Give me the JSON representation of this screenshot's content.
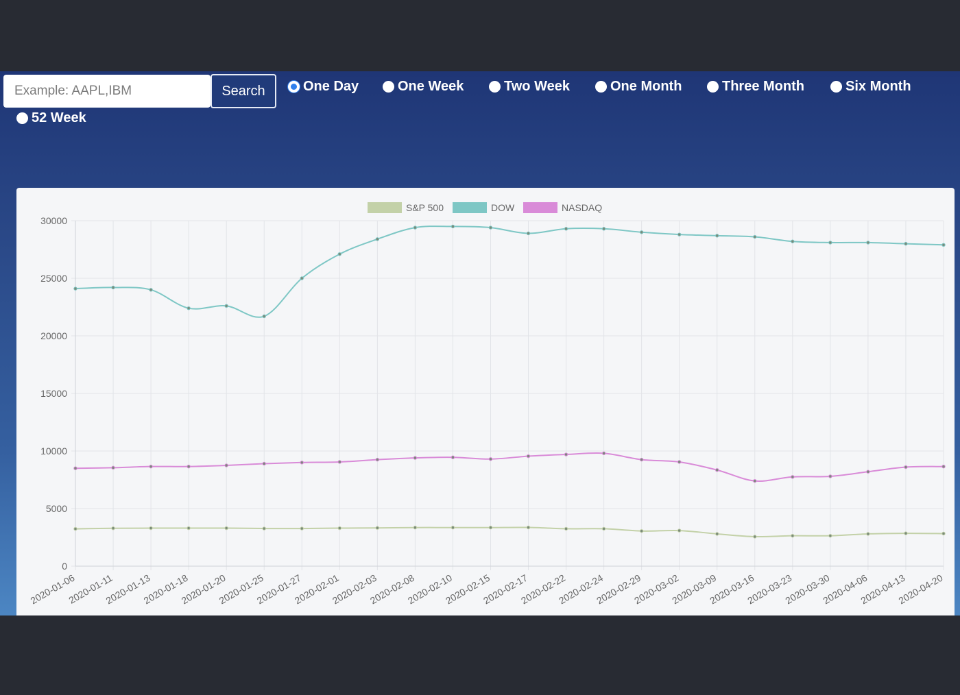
{
  "search": {
    "placeholder": "Example: AAPL,IBM",
    "value": "",
    "button_label": "Search"
  },
  "ranges": {
    "selected": "One Day",
    "options": [
      "One Day",
      "One Week",
      "Two Week",
      "One Month",
      "Three Month",
      "Six Month",
      "52 Week"
    ]
  },
  "chart_data": {
    "type": "line",
    "title": "",
    "xlabel": "",
    "ylabel": "",
    "ylim": [
      0,
      30000
    ],
    "yticks": [
      0,
      5000,
      10000,
      15000,
      20000,
      25000,
      30000
    ],
    "grid": true,
    "legend_position": "top",
    "categories": [
      "2020-01-06",
      "2020-01-11",
      "2020-01-13",
      "2020-01-18",
      "2020-01-20",
      "2020-01-25",
      "2020-01-27",
      "2020-02-01",
      "2020-02-03",
      "2020-02-08",
      "2020-02-10",
      "2020-02-15",
      "2020-02-17",
      "2020-02-22",
      "2020-02-24",
      "2020-02-29",
      "2020-03-02",
      "2020-03-09",
      "2020-03-16",
      "2020-03-23",
      "2020-03-30",
      "2020-04-06",
      "2020-04-13",
      "2020-04-20"
    ],
    "series": [
      {
        "name": "S&P 500",
        "color": "#c3d1a8",
        "values": [
          3240,
          3290,
          3300,
          3300,
          3300,
          3270,
          3270,
          3300,
          3320,
          3350,
          3350,
          3350,
          3360,
          3250,
          3250,
          3050,
          3090,
          2800,
          2560,
          2640,
          2640,
          2800,
          2850,
          2830
        ]
      },
      {
        "name": "DOW",
        "color": "#7ec7c5",
        "values": [
          24100,
          24200,
          24000,
          22400,
          22600,
          21700,
          25000,
          27100,
          28400,
          29400,
          29500,
          29400,
          28900,
          29300,
          29300,
          29000,
          28800,
          28700,
          28600,
          28200,
          28100,
          28100,
          28000,
          27900
        ]
      },
      {
        "name": "NASDAQ",
        "color": "#d98bd8",
        "values": [
          8500,
          8550,
          8650,
          8650,
          8750,
          8900,
          9000,
          9050,
          9250,
          9400,
          9450,
          9300,
          9550,
          9700,
          9800,
          9250,
          9050,
          8350,
          7400,
          7750,
          7800,
          8200,
          8600,
          8650
        ]
      }
    ]
  }
}
